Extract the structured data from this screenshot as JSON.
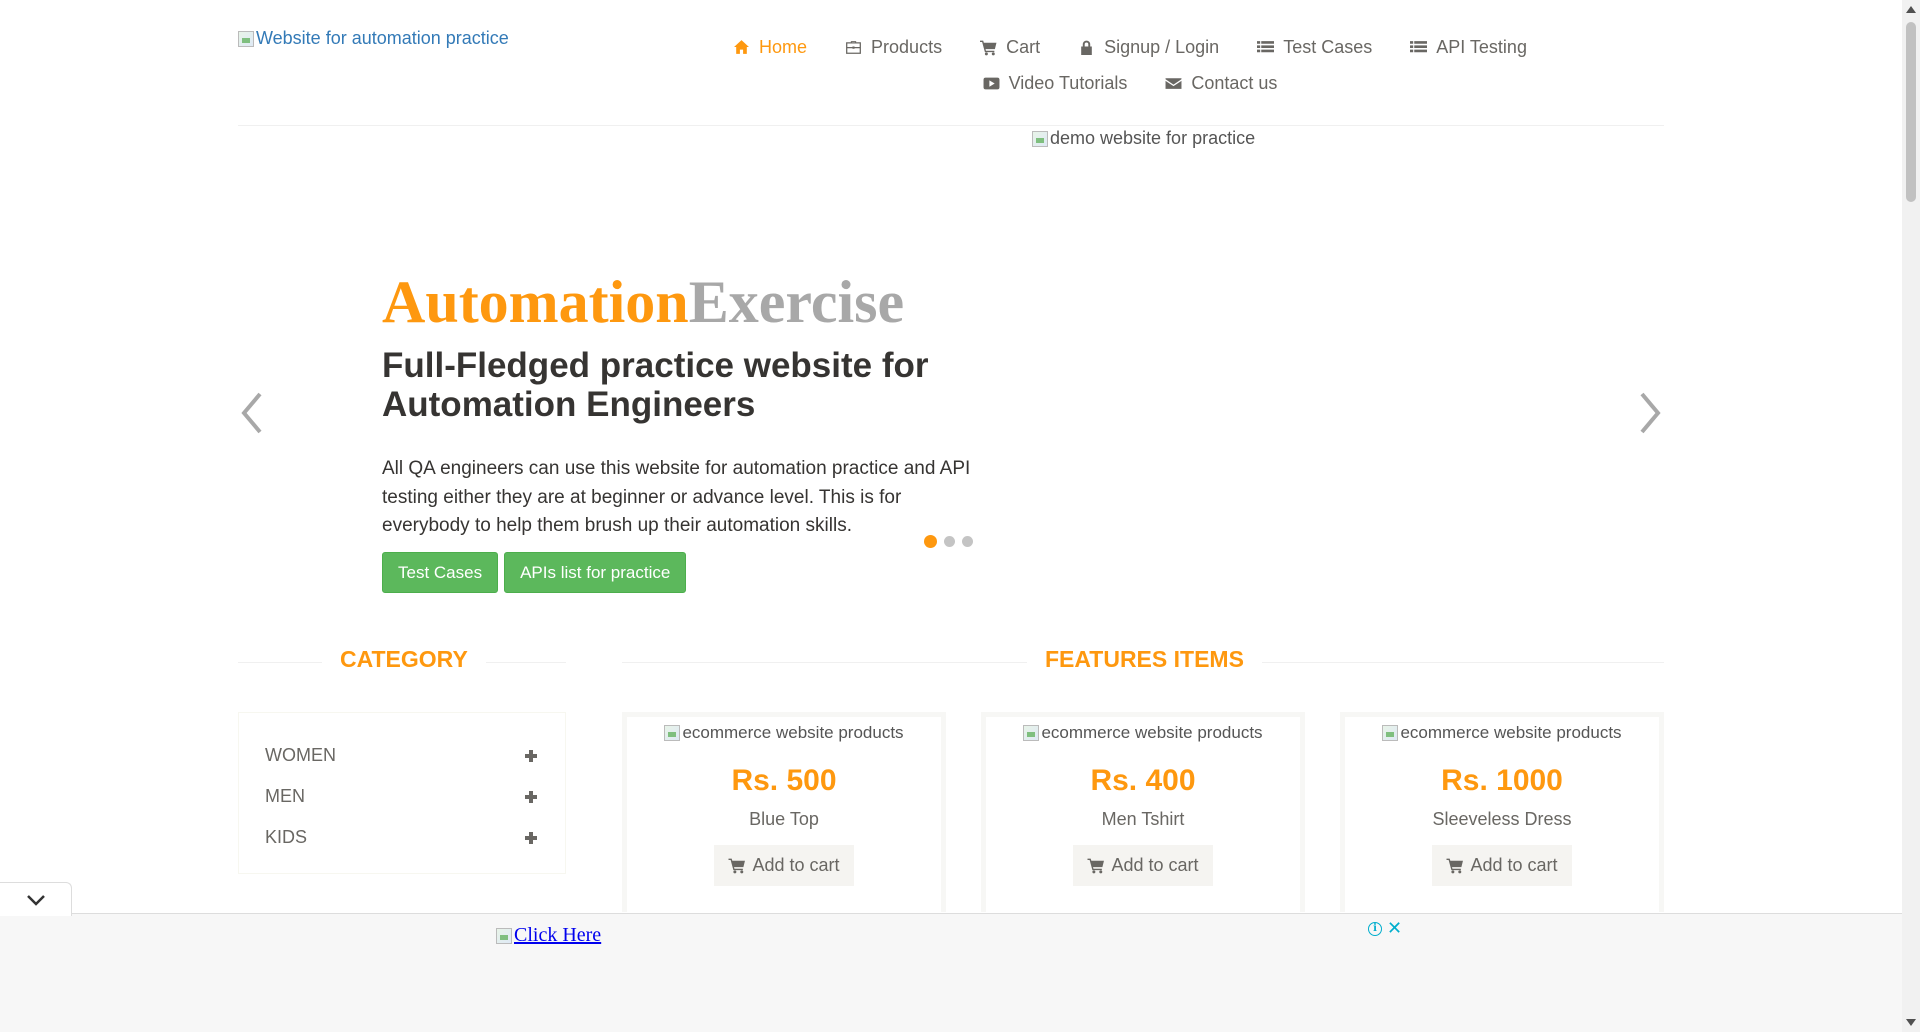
{
  "header": {
    "logo_alt": "Website for automation practice",
    "nav": [
      {
        "label": "Home",
        "icon": "home-icon",
        "active": true
      },
      {
        "label": "Products",
        "icon": "briefcase-icon"
      },
      {
        "label": "Cart",
        "icon": "cart-icon"
      },
      {
        "label": "Signup / Login",
        "icon": "lock-icon"
      },
      {
        "label": "Test Cases",
        "icon": "list-icon"
      },
      {
        "label": "API Testing",
        "icon": "list-icon"
      },
      {
        "label": "Video Tutorials",
        "icon": "youtube-icon"
      },
      {
        "label": "Contact us",
        "icon": "envelope-icon"
      }
    ]
  },
  "slider": {
    "image_alt": "demo website for practice",
    "brand_part1": "Automation",
    "brand_part2": "Exercise",
    "title": "Full-Fledged practice website for Automation Engineers",
    "text": "All QA engineers can use this website for automation practice and API testing either they are at beginner or advance level. This is for everybody to help them brush up their automation skills.",
    "btn_test_cases": "Test Cases",
    "btn_apis": "APIs list for practice",
    "active_slide": 1,
    "slide_count": 3
  },
  "category": {
    "title": "CATEGORY",
    "items": [
      "WOMEN",
      "MEN",
      "KIDS"
    ]
  },
  "features": {
    "title": "FEATURES ITEMS",
    "products": [
      {
        "image_alt": "ecommerce website products",
        "price": "Rs. 500",
        "name": "Blue Top",
        "button": "Add to cart"
      },
      {
        "image_alt": "ecommerce website products",
        "price": "Rs. 400",
        "name": "Men Tshirt",
        "button": "Add to cart"
      },
      {
        "image_alt": "ecommerce website products",
        "price": "Rs. 1000",
        "name": "Sleeveless Dress",
        "button": "Add to cart"
      }
    ]
  },
  "ad": {
    "link_text": "Click Here",
    "info_symbol": "i",
    "close_symbol": "✕"
  },
  "colors": {
    "accent": "#fe980f",
    "button_green": "#5cb85c",
    "text": "#696763",
    "heading": "#363432"
  }
}
